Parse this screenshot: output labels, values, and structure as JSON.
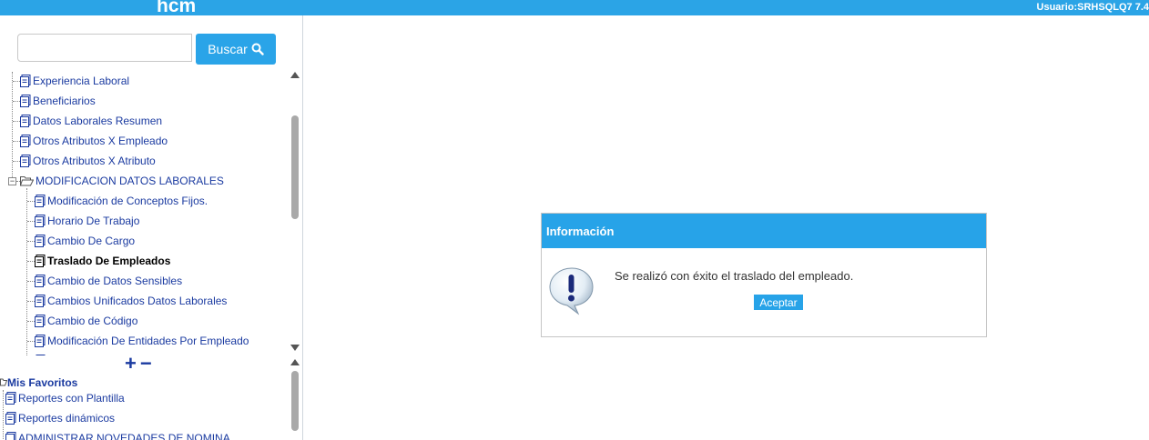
{
  "header": {
    "logo": "hcm",
    "user": "Usuario:SRHSQLQ7 7.4"
  },
  "search": {
    "placeholder": "",
    "button_label": "Buscar"
  },
  "tree": {
    "items": [
      {
        "label": "Experiencia Laboral"
      },
      {
        "label": "Beneficiarios"
      },
      {
        "label": "Datos Laborales Resumen"
      },
      {
        "label": "Otros Atributos X Empleado"
      },
      {
        "label": "Otros Atributos X Atributo"
      },
      {
        "label": "MODIFICACION DATOS LABORALES"
      },
      {
        "label": "Modificación de Conceptos Fijos."
      },
      {
        "label": "Horario De Trabajo"
      },
      {
        "label": "Cambio De Cargo"
      },
      {
        "label": "Traslado De Empleados"
      },
      {
        "label": "Cambio de Datos Sensibles"
      },
      {
        "label": "Cambios Unificados Datos Laborales"
      },
      {
        "label": "Cambio de Código"
      },
      {
        "label": "Modificación De Entidades Por Empleado"
      }
    ]
  },
  "controls": {
    "expand": "+",
    "collapse": "−"
  },
  "favorites": {
    "title": "Mis Favoritos",
    "items": [
      {
        "label": "Reportes con Plantilla"
      },
      {
        "label": "Reportes dinámicos"
      },
      {
        "label": "ADMINISTRAR NOVEDADES DE NOMINA"
      }
    ]
  },
  "dialog": {
    "title": "Información",
    "message": "Se realizó con éxito el traslado del empleado.",
    "ok_label": "Aceptar",
    "icon": "exclamation-bubble-icon"
  },
  "colors": {
    "brand": "#2ba4e6",
    "link": "#1a3aa0"
  }
}
